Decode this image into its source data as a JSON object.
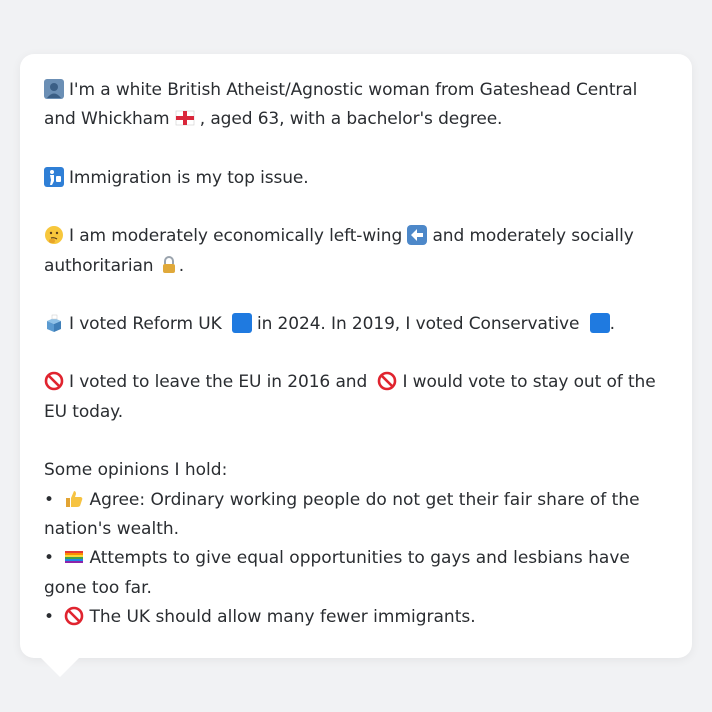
{
  "profile": {
    "identity": {
      "icon": "person-silhouette-icon",
      "text_pre": "I'm a white British Atheist/Agnostic woman from Gateshead Central and Whickham",
      "flag_icon": "england-flag-icon",
      "text_post": ", aged 63, with a bachelor's degree."
    },
    "top_issue": {
      "icon": "passport-control-icon",
      "text": "Immigration is my top issue."
    },
    "ideology": {
      "icon": "thinking-face-icon",
      "text_a": "I am moderately economically left-wing",
      "left_arrow_icon": "left-arrow-icon",
      "text_b": "and moderately socially authoritarian",
      "lock_icon": "lock-icon",
      "text_c": "."
    },
    "votes": {
      "icon": "ballot-box-icon",
      "text_a": "I voted Reform UK",
      "reform_color_icon": "blue-square-icon",
      "text_b": "in 2024. In 2019, I voted Conservative",
      "conservative_color_icon": "blue-square-icon",
      "text_c": "."
    },
    "brexit": {
      "icon": "prohibited-icon",
      "text_a": "I voted to leave the EU in 2016 and",
      "icon2": "prohibited-icon",
      "text_b": "I would vote to stay out of the EU today."
    },
    "opinions": {
      "title": "Some opinions I hold:",
      "bullet": "•",
      "items": [
        {
          "icon": "thumbs-up-icon",
          "text": "Agree: Ordinary working people do not get their fair share of the nation's wealth."
        },
        {
          "icon": "rainbow-flag-icon",
          "text": "Attempts to give equal opportunities to gays and lesbians have gone too far."
        },
        {
          "icon": "prohibited-icon",
          "text": "The UK should allow many fewer immigrants."
        }
      ]
    }
  },
  "colors": {
    "background": "#f1f2f4",
    "bubble": "#ffffff",
    "text": "#2a2d31",
    "blue_square": "#1f7ae0",
    "prohibited": "#e0242f"
  }
}
